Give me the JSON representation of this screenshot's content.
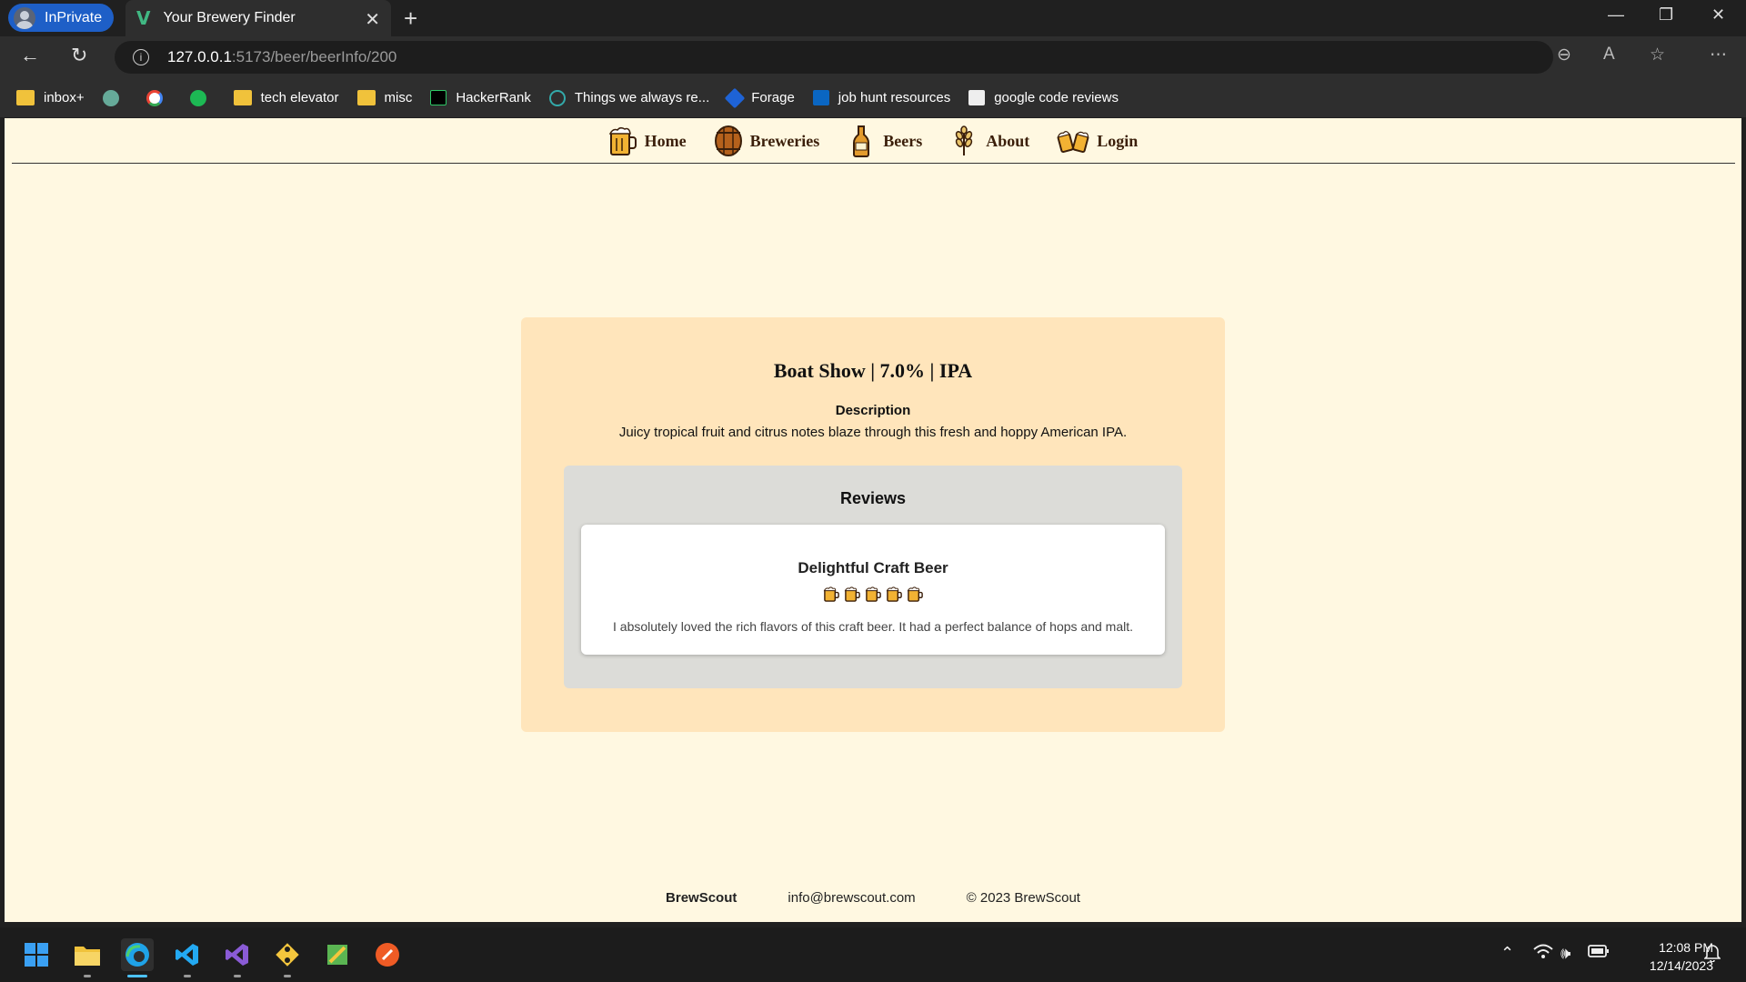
{
  "browser": {
    "profile_label": "InPrivate",
    "tab_title": "Your Brewery Finder",
    "url_host": "127.0.0.1",
    "url_rest": ":5173/beer/beerInfo/200",
    "bookmarks": [
      {
        "label": "inbox+",
        "icon": "folder-icon"
      },
      {
        "label": "",
        "icon": "chatgpt-icon"
      },
      {
        "label": "",
        "icon": "google-icon"
      },
      {
        "label": "",
        "icon": "spotify-icon"
      },
      {
        "label": "tech elevator",
        "icon": "folder-icon"
      },
      {
        "label": "misc",
        "icon": "folder-icon"
      },
      {
        "label": "HackerRank",
        "icon": "hackerrank-icon"
      },
      {
        "label": "Things we always re...",
        "icon": "page-icon"
      },
      {
        "label": "Forage",
        "icon": "forage-icon"
      },
      {
        "label": "job hunt resources",
        "icon": "linkedin-icon"
      },
      {
        "label": "google code reviews",
        "icon": "page-icon"
      }
    ]
  },
  "nav": {
    "home": "Home",
    "breweries": "Breweries",
    "beers": "Beers",
    "about": "About",
    "login": "Login"
  },
  "beer": {
    "title": "Boat Show | 7.0% | IPA",
    "description_heading": "Description",
    "description": "Juicy tropical fruit and citrus notes blaze through this fresh and hoppy American IPA."
  },
  "reviews": {
    "heading": "Reviews",
    "items": [
      {
        "title": "Delightful Craft Beer",
        "rating": 5,
        "rating_max": 5,
        "text": "I absolutely loved the rich flavors of this craft beer. It had a perfect balance of hops and malt."
      }
    ]
  },
  "footer": {
    "brand": "BrewScout",
    "email": "info@brewscout.com",
    "copyright": "© 2023 BrewScout"
  },
  "taskbar": {
    "time": "12:08 PM",
    "date": "12/14/2023"
  },
  "colors": {
    "page_bg": "#fff8e1",
    "card_bg": "#ffe5bb",
    "reviews_bg": "#dcdcd8",
    "nav_text": "#3b1f0a",
    "browser_accent": "#1e5fc7"
  }
}
